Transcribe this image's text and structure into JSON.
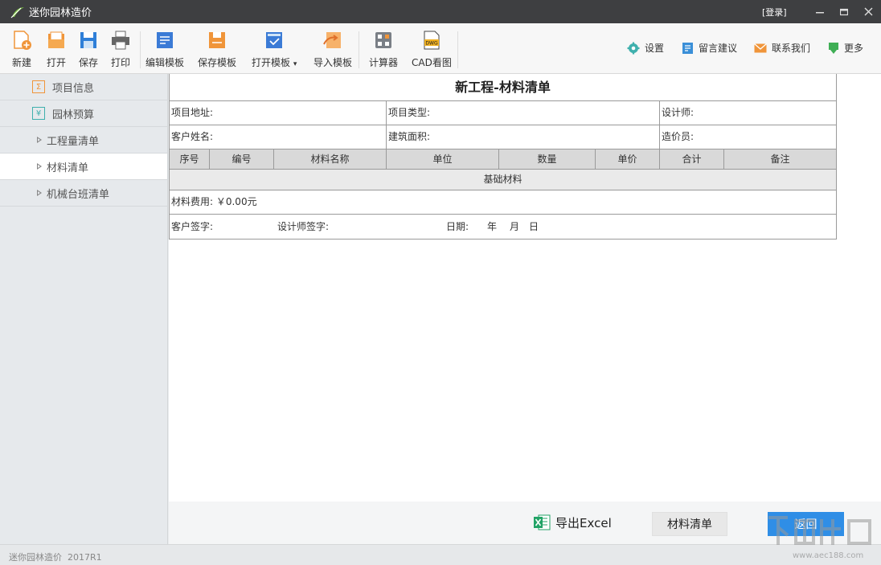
{
  "app": {
    "title": "迷你园林造价",
    "login": "[登录]"
  },
  "toolbar": {
    "new": "新建",
    "open": "打开",
    "save": "保存",
    "print": "打印",
    "edit_template": "编辑模板",
    "save_template": "保存模板",
    "open_template": "打开模板",
    "open_template_arrow": "▾",
    "import_template": "导入模板",
    "calculator": "计算器",
    "cad": "CAD看图",
    "cad_badge": "DWG",
    "settings": "设置",
    "feedback": "留言建议",
    "contact": "联系我们",
    "more": "更多"
  },
  "sidebar": {
    "items": [
      {
        "label": "项目信息",
        "icon_char": "Σ"
      },
      {
        "label": "园林预算",
        "icon_char": "¥"
      },
      {
        "label": "工程量清单"
      },
      {
        "label": "材料清单"
      },
      {
        "label": "机械台班清单"
      }
    ]
  },
  "doc": {
    "title": "新工程-材料清单",
    "project_address": "项目地址:",
    "project_type": "项目类型:",
    "designer": "设计师:",
    "customer_name": "客户姓名:",
    "building_area": "建筑面积:",
    "cost_engineer": "造价员:",
    "columns": [
      "序号",
      "编号",
      "材料名称",
      "单位",
      "数量",
      "单价",
      "合计",
      "备注"
    ],
    "section": "基础材料",
    "material_fee": "材料费用: ￥0.00元",
    "customer_sign": "客户签字:",
    "designer_sign": "设计师签字:",
    "date": "日期:",
    "year": "年",
    "month": "月",
    "day": "日"
  },
  "actions": {
    "export_excel": "导出Excel",
    "material_list": "材料清单",
    "back": "返回"
  },
  "status": {
    "text": "迷你园林造价  2017R1"
  },
  "watermark": {
    "text": "www.aec188.com"
  },
  "colors": {
    "titlebar": "#3e3f41",
    "accent": "#2f8ee6",
    "orange": "#f0953a",
    "teal": "#3fb0ad"
  }
}
